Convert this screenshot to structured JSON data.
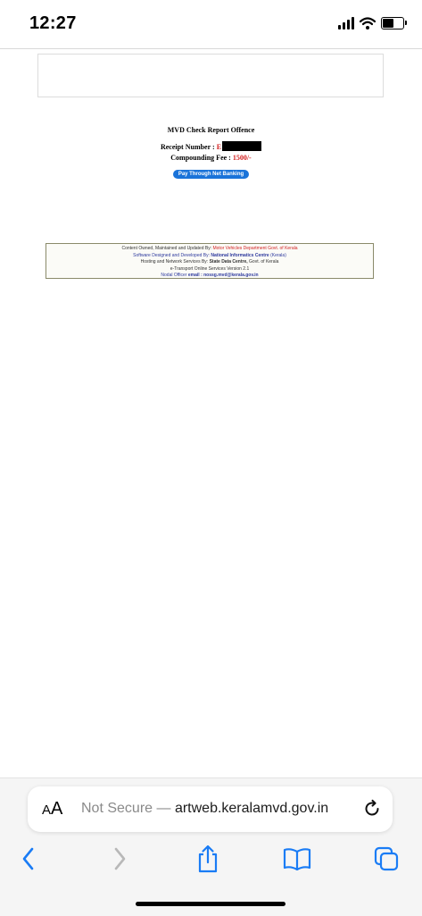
{
  "status_bar": {
    "time": "12:27",
    "battery_level": 0.5
  },
  "report": {
    "title": "MVD Check Report Offence",
    "receipt_label": "Receipt Number :",
    "receipt_value": "E",
    "fee_label": "Compounding Fee :",
    "fee_value": "1500/-",
    "pay_button": "Pay Through Net Banking"
  },
  "footer": {
    "owned_label": "Content Owned, Maintained and Updated By:",
    "owned_value": "Motor Vehicles Department Govt. of Kerala",
    "designed_label": "Software Designed and Developed By:",
    "designed_value": "National Informatics Centre",
    "designed_suffix": "(Kerala)",
    "hosting_label": "Hosting and Network Services By:",
    "hosting_value": "State Data Centre,",
    "hosting_suffix": "Govt. of Kerala",
    "version": "e-Transport Online Services Version 2.1",
    "nodal_label": "Nodal Officer",
    "email_label": "email :",
    "email_value": "nossg.mvd@kerala.gov.in"
  },
  "browser": {
    "aa_large": "A",
    "aa_small": "A",
    "url_prefix": "Not Secure —",
    "url_domain": "artweb.keralamvd.gov.in"
  },
  "colors": {
    "accent": "#1a73d9",
    "highlight_red": "#d21f1f",
    "ios_blue": "#1a7cf5"
  },
  "icons": [
    "signal-icon",
    "wifi-icon",
    "battery-icon",
    "reload-icon",
    "back-icon",
    "forward-icon",
    "share-icon",
    "bookmarks-icon",
    "tabs-icon"
  ]
}
